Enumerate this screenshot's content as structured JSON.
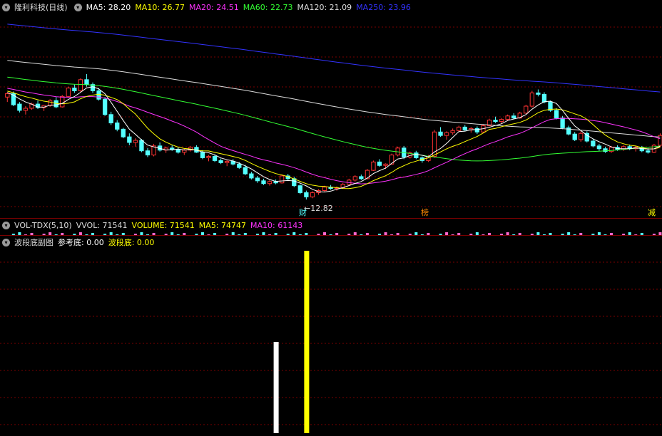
{
  "main_header": {
    "title": "隆利科技(日线)",
    "ma": [
      {
        "label": "MA5: 28.20",
        "color": "#ffffff"
      },
      {
        "label": "MA10: 26.77",
        "color": "#ffff00"
      },
      {
        "label": "MA20: 24.51",
        "color": "#ff33ff"
      },
      {
        "label": "MA60: 22.73",
        "color": "#33ff33"
      },
      {
        "label": "MA120: 21.09",
        "color": "#dddddd"
      },
      {
        "label": "MA250: 23.96",
        "color": "#3333ff"
      }
    ]
  },
  "vol_header": {
    "name": "VOL-TDX(5,10)",
    "items": [
      {
        "label": "VVOL: 71541",
        "color": "#dddddd"
      },
      {
        "label": "VOLUME: 71541",
        "color": "#ffff00"
      },
      {
        "label": "MA5: 74747",
        "color": "#ffff00"
      },
      {
        "label": "MA10: 61143",
        "color": "#ff33ff"
      }
    ]
  },
  "sub_header": {
    "name": "波段底副图",
    "items": [
      {
        "label": "参考底: 0.00",
        "color": "#ffffff"
      },
      {
        "label": "波段底: 0.00",
        "color": "#ffff00"
      }
    ]
  },
  "markers": {
    "low_label": "←12.82",
    "cai": "财",
    "bang": "榜",
    "jian": "减"
  },
  "colors": {
    "up": "#ff3333",
    "down": "#54ffff",
    "grid": "#7a0000",
    "ma5": "#ffffff",
    "ma10": "#ffff00",
    "ma20": "#ff33ff",
    "ma60": "#33ff33",
    "ma120": "#dddddd",
    "ma250": "#3333ff"
  },
  "chart_data": {
    "type": "candlestick",
    "low_price": 12.82,
    "candles": [
      [
        27.5,
        28.2,
        26.8,
        28.0
      ],
      [
        28.0,
        28.3,
        26.2,
        26.4
      ],
      [
        26.5,
        26.8,
        25.3,
        25.6
      ],
      [
        25.6,
        26.2,
        25.0,
        25.9
      ],
      [
        25.9,
        26.7,
        25.7,
        26.5
      ],
      [
        26.5,
        27.0,
        25.8,
        26.0
      ],
      [
        26.0,
        26.4,
        25.5,
        26.3
      ],
      [
        26.3,
        27.2,
        26.1,
        27.0
      ],
      [
        27.0,
        27.5,
        25.9,
        26.1
      ],
      [
        26.1,
        27.8,
        26.0,
        27.6
      ],
      [
        27.6,
        29.0,
        27.4,
        28.8
      ],
      [
        28.8,
        29.3,
        28.1,
        28.4
      ],
      [
        28.4,
        30.2,
        28.2,
        30.0
      ],
      [
        30.0,
        30.8,
        29.0,
        29.3
      ],
      [
        29.3,
        29.6,
        28.1,
        28.4
      ],
      [
        28.4,
        28.8,
        27.0,
        27.2
      ],
      [
        27.2,
        27.5,
        24.8,
        25.0
      ],
      [
        25.0,
        25.4,
        23.5,
        23.8
      ],
      [
        23.8,
        24.2,
        22.6,
        22.9
      ],
      [
        22.9,
        23.1,
        21.6,
        21.8
      ],
      [
        21.8,
        22.3,
        20.6,
        21.0
      ],
      [
        21.0,
        21.6,
        20.4,
        21.3
      ],
      [
        21.3,
        21.5,
        19.6,
        19.8
      ],
      [
        19.8,
        20.2,
        18.9,
        19.2
      ],
      [
        19.2,
        20.8,
        19.0,
        20.5
      ],
      [
        20.5,
        21.0,
        19.7,
        19.9
      ],
      [
        19.9,
        20.4,
        19.5,
        20.2
      ],
      [
        20.2,
        20.6,
        19.8,
        20.0
      ],
      [
        20.0,
        20.3,
        19.4,
        19.6
      ],
      [
        19.6,
        20.1,
        19.2,
        19.9
      ],
      [
        19.9,
        20.5,
        19.7,
        20.3
      ],
      [
        20.3,
        20.6,
        19.5,
        19.6
      ],
      [
        19.6,
        19.9,
        18.6,
        18.8
      ],
      [
        18.8,
        19.2,
        18.3,
        19.0
      ],
      [
        19.0,
        19.3,
        18.2,
        18.4
      ],
      [
        18.4,
        18.7,
        17.9,
        18.1
      ],
      [
        18.1,
        18.5,
        17.6,
        18.3
      ],
      [
        18.3,
        18.6,
        17.7,
        17.9
      ],
      [
        17.9,
        18.2,
        17.2,
        17.4
      ],
      [
        17.4,
        17.8,
        16.3,
        16.5
      ],
      [
        16.5,
        16.8,
        15.7,
        15.9
      ],
      [
        15.9,
        16.2,
        15.2,
        15.5
      ],
      [
        15.5,
        15.8,
        14.9,
        15.1
      ],
      [
        15.1,
        15.6,
        14.8,
        15.4
      ],
      [
        15.4,
        15.7,
        15.0,
        15.2
      ],
      [
        15.2,
        16.4,
        15.1,
        16.2
      ],
      [
        16.2,
        16.5,
        15.6,
        15.8
      ],
      [
        15.8,
        16.1,
        14.6,
        14.8
      ],
      [
        14.8,
        15.0,
        13.6,
        13.8
      ],
      [
        13.8,
        14.1,
        12.82,
        13.2
      ],
      [
        13.2,
        14.0,
        13.0,
        13.8
      ],
      [
        13.8,
        14.3,
        13.5,
        14.1
      ],
      [
        14.1,
        14.8,
        13.9,
        14.6
      ],
      [
        14.6,
        14.9,
        14.2,
        14.4
      ],
      [
        14.4,
        14.7,
        14.1,
        14.5
      ],
      [
        14.5,
        15.2,
        14.4,
        15.0
      ],
      [
        15.0,
        15.8,
        14.9,
        15.6
      ],
      [
        15.6,
        16.3,
        15.4,
        16.1
      ],
      [
        16.1,
        16.4,
        15.6,
        15.8
      ],
      [
        15.8,
        17.2,
        15.7,
        17.0
      ],
      [
        17.0,
        18.4,
        16.9,
        18.2
      ],
      [
        18.2,
        18.6,
        17.5,
        17.7
      ],
      [
        17.7,
        18.0,
        17.2,
        17.9
      ],
      [
        17.9,
        19.4,
        17.8,
        19.2
      ],
      [
        19.2,
        20.4,
        19.0,
        20.2
      ],
      [
        20.2,
        20.5,
        18.6,
        18.9
      ],
      [
        18.9,
        19.7,
        18.7,
        19.5
      ],
      [
        19.5,
        19.8,
        18.6,
        18.8
      ],
      [
        18.8,
        19.0,
        18.1,
        18.4
      ],
      [
        18.4,
        19.2,
        18.2,
        19.0
      ],
      [
        19.0,
        22.8,
        18.8,
        22.5
      ],
      [
        22.5,
        23.2,
        21.8,
        22.0
      ],
      [
        22.0,
        22.6,
        21.4,
        22.4
      ],
      [
        22.4,
        23.0,
        22.1,
        22.7
      ],
      [
        22.7,
        23.4,
        22.5,
        23.2
      ],
      [
        23.2,
        23.5,
        22.6,
        22.8
      ],
      [
        22.8,
        23.2,
        22.4,
        23.0
      ],
      [
        23.0,
        23.3,
        22.2,
        22.5
      ],
      [
        22.5,
        23.6,
        22.3,
        23.4
      ],
      [
        23.4,
        24.4,
        23.3,
        24.2
      ],
      [
        24.2,
        24.7,
        23.8,
        24.0
      ],
      [
        24.0,
        24.5,
        23.7,
        24.3
      ],
      [
        24.3,
        25.0,
        24.1,
        24.8
      ],
      [
        24.8,
        25.2,
        24.3,
        24.5
      ],
      [
        24.5,
        25.4,
        24.4,
        25.2
      ],
      [
        25.2,
        26.4,
        25.1,
        26.2
      ],
      [
        26.2,
        28.4,
        26.0,
        28.1
      ],
      [
        28.1,
        28.6,
        27.6,
        27.9
      ],
      [
        27.9,
        28.2,
        26.6,
        26.8
      ],
      [
        26.8,
        27.0,
        25.4,
        25.6
      ],
      [
        25.6,
        25.9,
        24.3,
        24.5
      ],
      [
        24.5,
        24.8,
        22.9,
        23.1
      ],
      [
        23.1,
        23.4,
        22.0,
        22.2
      ],
      [
        22.2,
        22.5,
        21.2,
        21.4
      ],
      [
        21.4,
        22.6,
        21.1,
        22.3
      ],
      [
        22.3,
        22.6,
        21.0,
        21.2
      ],
      [
        21.2,
        21.5,
        20.3,
        20.5
      ],
      [
        20.5,
        20.8,
        19.8,
        20.1
      ],
      [
        20.1,
        20.4,
        19.5,
        19.7
      ],
      [
        19.7,
        20.5,
        19.5,
        20.3
      ],
      [
        20.3,
        20.6,
        19.8,
        20.0
      ],
      [
        20.0,
        20.6,
        19.8,
        20.4
      ],
      [
        20.4,
        20.7,
        19.9,
        20.1
      ],
      [
        20.1,
        20.5,
        19.7,
        20.3
      ],
      [
        20.3,
        20.5,
        19.6,
        19.8
      ],
      [
        19.8,
        20.2,
        19.4,
        19.6
      ],
      [
        19.6,
        20.8,
        19.5,
        20.6
      ],
      [
        20.6,
        22.3,
        20.4,
        22.0
      ]
    ],
    "sub_bars": [
      {
        "name": "参考底",
        "index": 44,
        "value": 0.5,
        "color": "#ffffff"
      },
      {
        "name": "波段底",
        "index": 49,
        "value": 1.0,
        "color": "#ffff00"
      }
    ]
  }
}
